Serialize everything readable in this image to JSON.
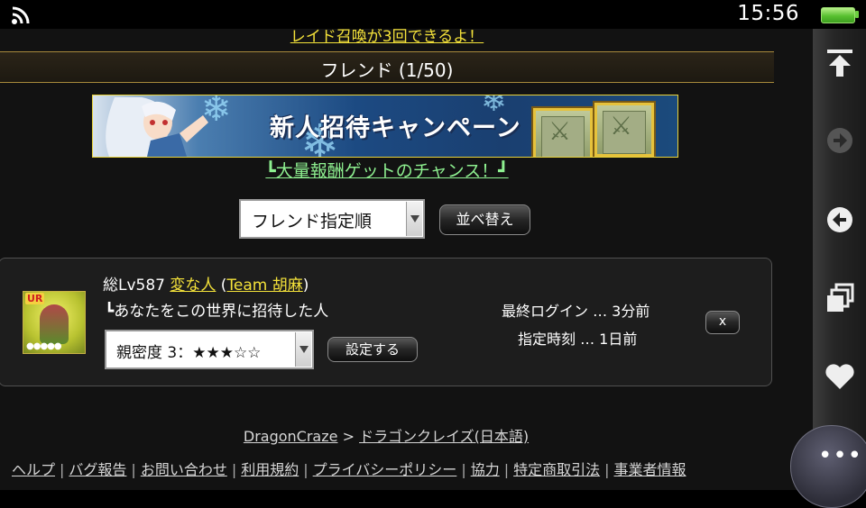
{
  "status": {
    "time": "15:56",
    "icons": {
      "signal": "wifi-signal-icon",
      "battery": "battery-full-icon"
    }
  },
  "page": {
    "raid_link": "レイド召喚が3回できるよ！",
    "header_title": "フレンド (1/50)",
    "banner": {
      "text": "新人招待キャンペーン"
    },
    "campaign_link": "┗大量報酬ゲットのチャンス！┛",
    "sort": {
      "selected": "フレンド指定順",
      "button": "並べ替え"
    },
    "friend": {
      "level_prefix": "総Lv587",
      "name": "変な人",
      "team": "Team 胡麻",
      "avatar_rank": "UR",
      "note": "┗あなたをこの世界に招待した人",
      "affinity": "親密度 3：★★★☆☆",
      "set_button": "設定する",
      "last_login": "最終ログイン … 3分前",
      "assigned_time": "指定時刻 … 1日前",
      "remove_button": "x"
    },
    "breadcrumb": {
      "site": "DragonCraze",
      "separator": ">",
      "game": "ドラゴンクレイズ(日本語)"
    },
    "footer_links": [
      "ヘルプ",
      "バグ報告",
      "お問い合わせ",
      "利用規約",
      "プライバシーポリシー",
      "協力",
      "特定商取引法",
      "事業者情報"
    ]
  },
  "sidebar": {
    "icons": [
      "scroll-top-icon",
      "forward-icon",
      "back-icon",
      "windows-icon",
      "favorite-heart-icon"
    ],
    "more_button": "options-more-icon"
  },
  "colors": {
    "link_yellow": "#f4e23a",
    "link_green": "#8ef090",
    "header_border": "#a88a3c",
    "battery_green": "#58c030"
  }
}
